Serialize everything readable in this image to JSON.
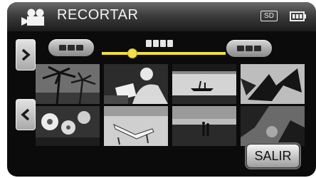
{
  "header": {
    "title": "RECORTAR",
    "mode_icon": "video-camera-icon",
    "sd_label": "SD",
    "battery_icon": "battery-icon"
  },
  "scrubber": {
    "start_button_icon": "start-point-button",
    "end_button_icon": "end-point-button",
    "accent_color": "#f2df3c"
  },
  "nav": {
    "next_icon": "chevron-right-icon",
    "prev_icon": "chevron-left-icon"
  },
  "thumbnails": [
    {
      "subject": "palm-trees"
    },
    {
      "subject": "person-reading"
    },
    {
      "subject": "canoe-on-lake"
    },
    {
      "subject": "leaves"
    },
    {
      "subject": "flowers"
    },
    {
      "subject": "beach-chair"
    },
    {
      "subject": "couple-at-sunset"
    },
    {
      "subject": "dark-foliage"
    }
  ],
  "footer": {
    "exit_label": "SALIR"
  }
}
